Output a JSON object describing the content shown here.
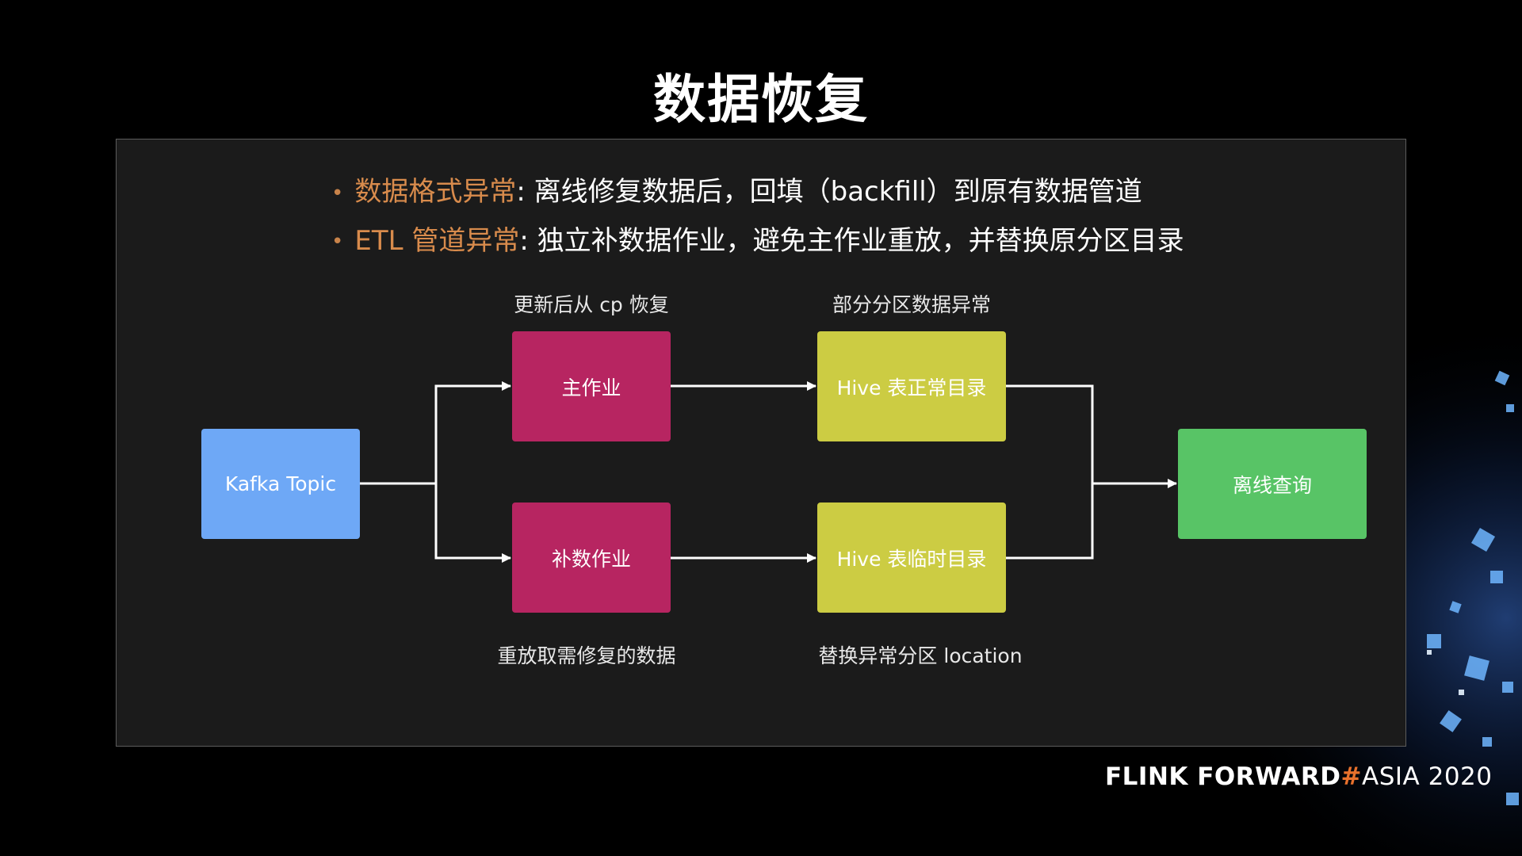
{
  "title": "数据恢复",
  "bullets": [
    {
      "highlight": "数据格式异常",
      "text": ": 离线修复数据后，回填（backfill）到原有数据管道"
    },
    {
      "highlight": "ETL 管道异常",
      "text": ": 独立补数据作业，避免主作业重放，并替换原分区目录"
    }
  ],
  "captions": {
    "top_left": "更新后从 cp 恢复",
    "top_right": "部分分区数据异常",
    "bottom_left": "重放取需修复的数据",
    "bottom_right": "替换异常分区 location"
  },
  "nodes": {
    "kafka": "Kafka Topic",
    "main_job": "主作业",
    "backfill_job": "补数作业",
    "hive_normal": "Hive 表正常目录",
    "hive_temp": "Hive 表临时目录",
    "offline": "离线查询"
  },
  "brand": {
    "part1": "FLINK  FORWARD",
    "hash": "#",
    "part2": "ASIA 2020"
  },
  "colors": {
    "highlight": "#d88b4c",
    "kafka": "#6ea8f6",
    "job": "#b72561",
    "hive": "#cccc43",
    "offline": "#58c466",
    "hash": "#e8712c"
  }
}
